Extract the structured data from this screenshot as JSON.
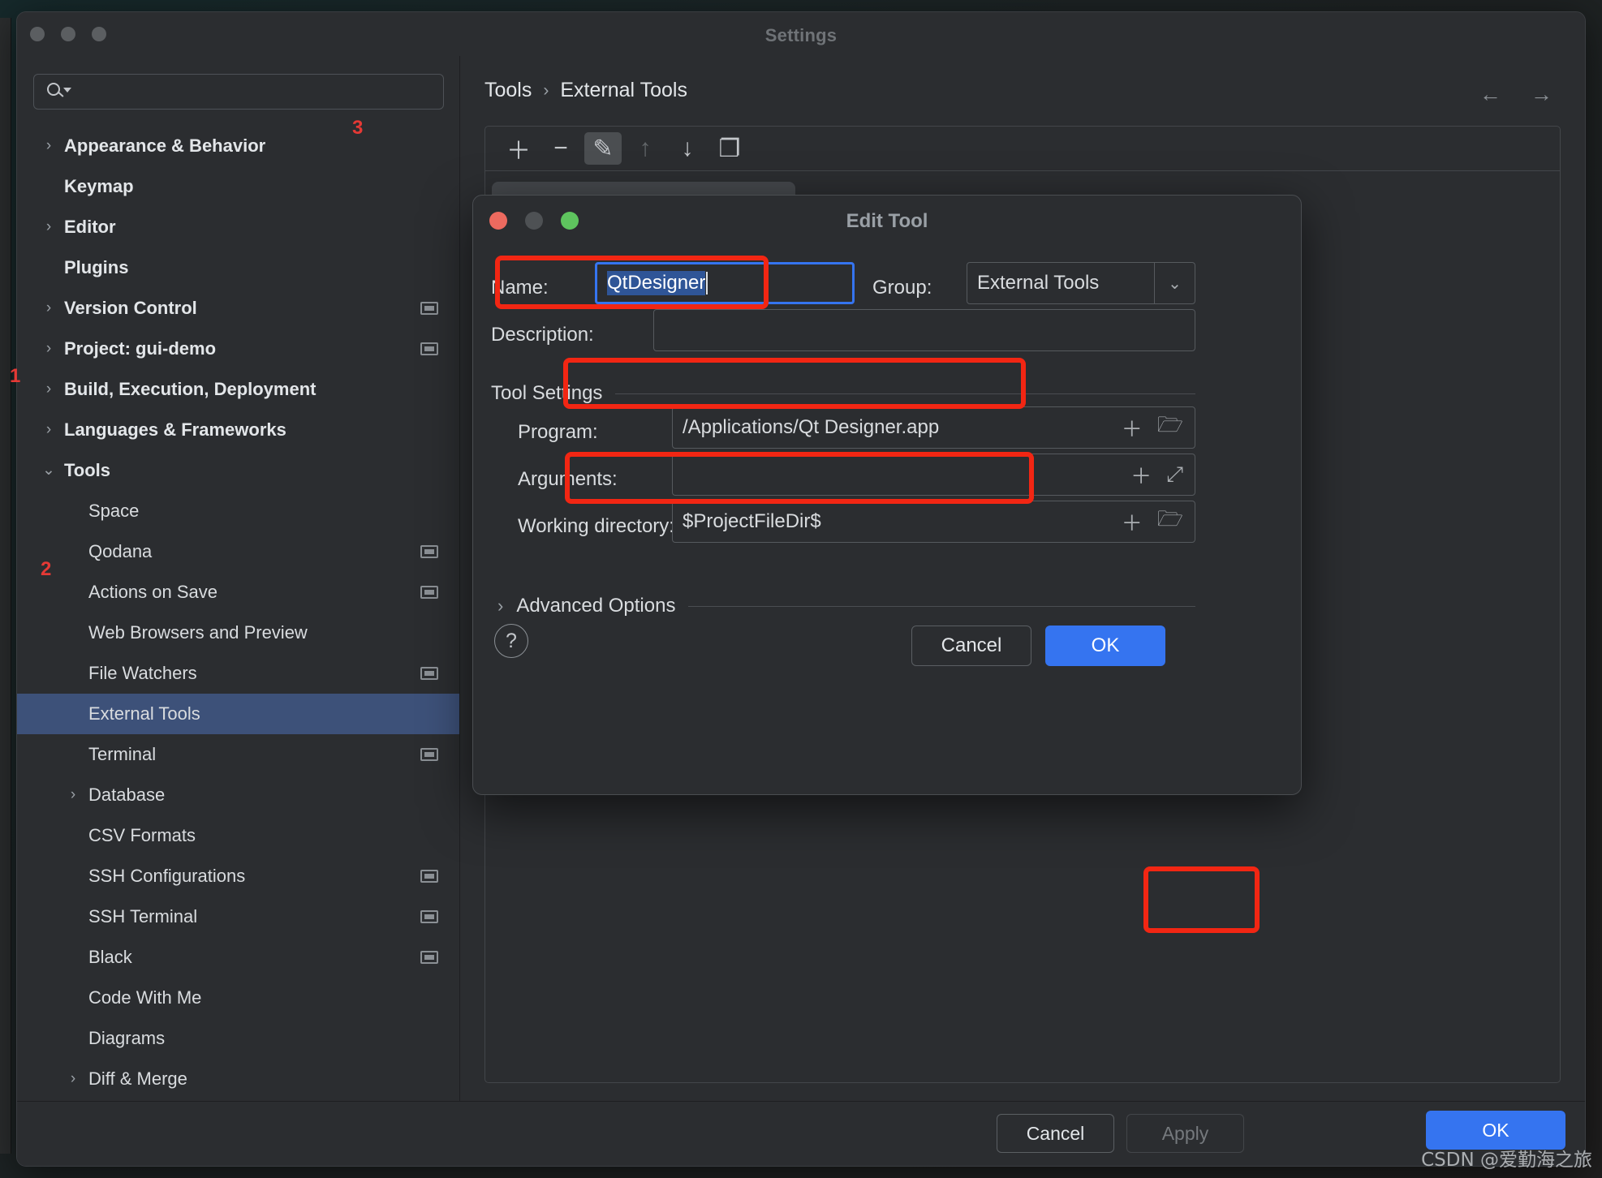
{
  "window": {
    "title": "Settings",
    "traffic_lights": [
      "close",
      "minimize",
      "zoom"
    ]
  },
  "search": {
    "placeholder": "",
    "value": "",
    "icon": "search-icon"
  },
  "sidebar": {
    "items": [
      {
        "label": "Appearance & Behavior",
        "chevron": "›",
        "level": 0,
        "bold": true,
        "badge": false,
        "selected": false,
        "marker": ""
      },
      {
        "label": "Keymap",
        "chevron": "",
        "level": 0,
        "bold": true,
        "badge": false,
        "selected": false,
        "marker": ""
      },
      {
        "label": "Editor",
        "chevron": "›",
        "level": 0,
        "bold": true,
        "badge": false,
        "selected": false,
        "marker": ""
      },
      {
        "label": "Plugins",
        "chevron": "",
        "level": 0,
        "bold": true,
        "badge": false,
        "selected": false,
        "marker": ""
      },
      {
        "label": "Version Control",
        "chevron": "›",
        "level": 0,
        "bold": true,
        "badge": true,
        "selected": false,
        "marker": ""
      },
      {
        "label": "Project: gui-demo",
        "chevron": "›",
        "level": 0,
        "bold": true,
        "badge": true,
        "selected": false,
        "marker": ""
      },
      {
        "label": "Build, Execution, Deployment",
        "chevron": "›",
        "level": 0,
        "bold": true,
        "badge": false,
        "selected": false,
        "marker": ""
      },
      {
        "label": "Languages & Frameworks",
        "chevron": "›",
        "level": 0,
        "bold": true,
        "badge": false,
        "selected": false,
        "marker": ""
      },
      {
        "label": "Tools",
        "chevron": "⌄",
        "level": 0,
        "bold": true,
        "badge": false,
        "selected": false,
        "marker": "1"
      },
      {
        "label": "Space",
        "chevron": "",
        "level": 1,
        "bold": false,
        "badge": false,
        "selected": false,
        "marker": ""
      },
      {
        "label": "Qodana",
        "chevron": "",
        "level": 1,
        "bold": false,
        "badge": true,
        "selected": false,
        "marker": ""
      },
      {
        "label": "Actions on Save",
        "chevron": "",
        "level": 1,
        "bold": false,
        "badge": true,
        "selected": false,
        "marker": ""
      },
      {
        "label": "Web Browsers and Preview",
        "chevron": "",
        "level": 1,
        "bold": false,
        "badge": false,
        "selected": false,
        "marker": ""
      },
      {
        "label": "File Watchers",
        "chevron": "",
        "level": 1,
        "bold": false,
        "badge": true,
        "selected": false,
        "marker": ""
      },
      {
        "label": "External Tools",
        "chevron": "",
        "level": 1,
        "bold": false,
        "badge": false,
        "selected": true,
        "marker": "2"
      },
      {
        "label": "Terminal",
        "chevron": "",
        "level": 1,
        "bold": false,
        "badge": true,
        "selected": false,
        "marker": ""
      },
      {
        "label": "Database",
        "chevron": "›",
        "level": 1,
        "bold": false,
        "badge": false,
        "selected": false,
        "marker": ""
      },
      {
        "label": "CSV Formats",
        "chevron": "",
        "level": 1,
        "bold": false,
        "badge": false,
        "selected": false,
        "marker": ""
      },
      {
        "label": "SSH Configurations",
        "chevron": "",
        "level": 1,
        "bold": false,
        "badge": true,
        "selected": false,
        "marker": ""
      },
      {
        "label": "SSH Terminal",
        "chevron": "",
        "level": 1,
        "bold": false,
        "badge": true,
        "selected": false,
        "marker": ""
      },
      {
        "label": "Black",
        "chevron": "",
        "level": 1,
        "bold": false,
        "badge": true,
        "selected": false,
        "marker": ""
      },
      {
        "label": "Code With Me",
        "chevron": "",
        "level": 1,
        "bold": false,
        "badge": false,
        "selected": false,
        "marker": ""
      },
      {
        "label": "Diagrams",
        "chevron": "",
        "level": 1,
        "bold": false,
        "badge": false,
        "selected": false,
        "marker": ""
      },
      {
        "label": "Diff & Merge",
        "chevron": "›",
        "level": 1,
        "bold": false,
        "badge": false,
        "selected": false,
        "marker": ""
      }
    ],
    "help_icon": "?"
  },
  "breadcrumb": {
    "parent": "Tools",
    "separator": "›",
    "current": "External Tools"
  },
  "nav": {
    "back": "←",
    "forward": "→"
  },
  "toolbar": {
    "buttons": [
      {
        "icon": "plus-icon",
        "glyph": "＋",
        "state": "enabled"
      },
      {
        "icon": "minus-icon",
        "glyph": "−",
        "state": "enabled"
      },
      {
        "icon": "edit-pencil-icon",
        "glyph": "✎",
        "state": "active"
      },
      {
        "icon": "move-up-icon",
        "glyph": "↑",
        "state": "disabled"
      },
      {
        "icon": "move-down-icon",
        "glyph": "↓",
        "state": "enabled"
      },
      {
        "icon": "copy-icon",
        "glyph": "❐",
        "state": "enabled"
      }
    ]
  },
  "footer": {
    "cancel": "Cancel",
    "apply": "Apply",
    "ok": "OK"
  },
  "watermark": "CSDN @爱勤海之旅",
  "dialog": {
    "title": "Edit Tool",
    "traffic_lights": [
      "close",
      "minimize",
      "zoom"
    ],
    "name_label": "Name:",
    "name_value": "QtDesigner",
    "group_label": "Group:",
    "group_value": "External Tools",
    "group_arrow": "⌄",
    "description_label": "Description:",
    "description_value": "",
    "tool_settings_label": "Tool Settings",
    "program_label": "Program:",
    "program_value": "/Applications/Qt Designer.app",
    "program_icons": [
      "insert-macro-icon",
      "browse-folder-icon"
    ],
    "arguments_label": "Arguments:",
    "arguments_value": "",
    "arguments_icons": [
      "insert-macro-icon",
      "expand-icon"
    ],
    "working_dir_label": "Working directory:",
    "working_dir_value": "$ProjectFileDir$",
    "working_dir_icons": [
      "insert-macro-icon",
      "browse-folder-icon"
    ],
    "advanced_label": "Advanced Options",
    "advanced_chevron": "›",
    "help_icon": "?",
    "cancel": "Cancel",
    "ok": "OK"
  },
  "annotations": [
    {
      "number": "1",
      "target": "Tools"
    },
    {
      "number": "2",
      "target": "External Tools"
    },
    {
      "number": "3",
      "target": "toolbar"
    }
  ],
  "colors": {
    "accent": "#3574f0",
    "highlight_red": "#f22613",
    "selection_blue": "#3d5179",
    "text_selection": "#2f5597",
    "window_bg": "#2b2d30",
    "marker_red": "#e53935"
  }
}
